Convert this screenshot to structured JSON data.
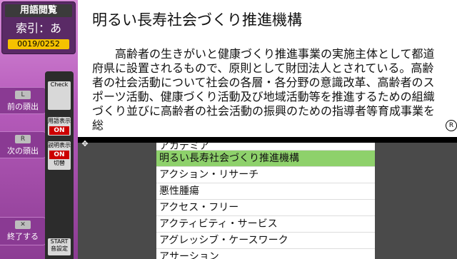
{
  "left": {
    "title": "用語閲覧",
    "index_label": "索引：あ",
    "counter": "0019/0252",
    "prev_key": "L",
    "prev_label": "前の頭出",
    "next_key": "R",
    "next_label": "次の頭出",
    "quit_key": "✕",
    "quit_label": "終了する",
    "start_key": "START",
    "start_label": "音設定",
    "check_label": "Check",
    "term_display_label": "用語表示",
    "term_display_state": "ON",
    "desc_display_label": "説明表示",
    "desc_display_state": "ON",
    "toggle_label": "切替"
  },
  "top": {
    "title": "明るい長寿社会づくり推進機構",
    "description": "高齢者の生きがいと健康づくり推進事業の実施主体として都道府県に設置されるもので、原則として財団法人とされている。高齢者の社会活動について社会の各層・各分野の意識改革、高齢者のスポーツ活動、健康づくり活動及び地域活動等を推進するための組織づくり並びに高齢者の社会活動の振興のための指導者等育成事業を総"
  },
  "list": {
    "rows": [
      "アカデミア",
      "明るい長寿社会づくり推進機構",
      "アクション・リサーチ",
      "悪性腫瘍",
      "アクセス・フリー",
      "アクティビティ・サービス",
      "アグレッシブ・ケースワーク",
      "アサーション"
    ],
    "selected_index": 1
  }
}
